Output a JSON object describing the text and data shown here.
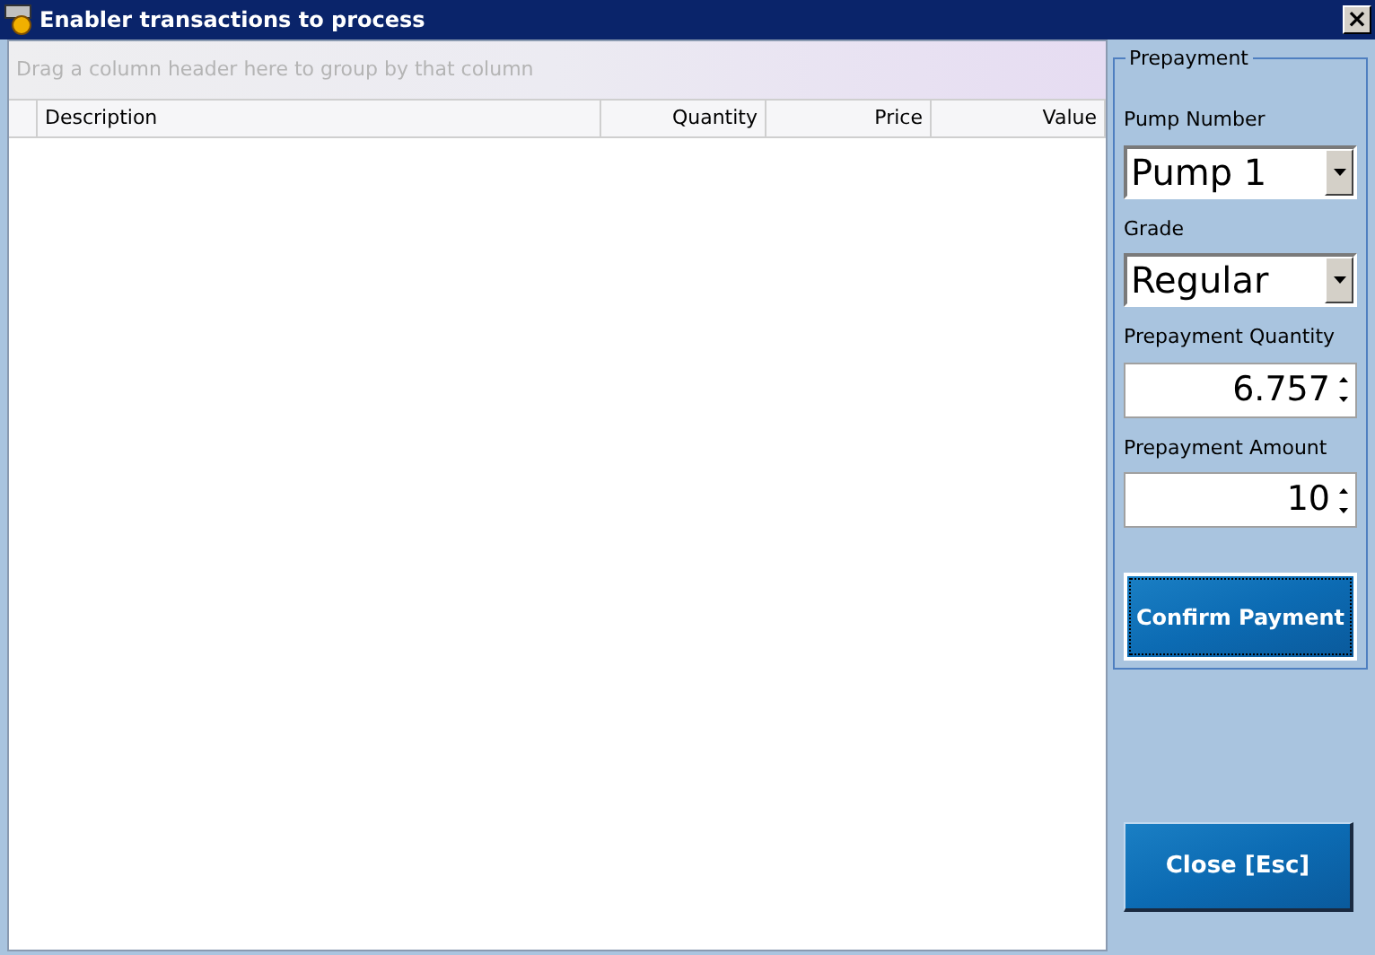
{
  "window": {
    "title": "Enabler transactions to process",
    "close": "×"
  },
  "grid": {
    "group_hint": "Drag a column header here to group by that column",
    "columns": [
      {
        "label": "Description",
        "kind": "text"
      },
      {
        "label": "Quantity",
        "kind": "number"
      },
      {
        "label": "Price",
        "kind": "number"
      },
      {
        "label": "Value",
        "kind": "number"
      }
    ]
  },
  "prepayment": {
    "title": "Prepayment",
    "fields": [
      {
        "kind": "dropdown",
        "label": "Pump Number",
        "value": "Pump 1"
      },
      {
        "kind": "dropdown",
        "label": "Grade",
        "value": "Regular"
      },
      {
        "kind": "spin",
        "label": "Prepayment Quantity",
        "value": "6.757"
      },
      {
        "kind": "spin",
        "label": "Prepayment Amount",
        "value": "10"
      }
    ],
    "confirm_button": "Confirm Payment"
  },
  "close_button": "Close [Esc]"
}
